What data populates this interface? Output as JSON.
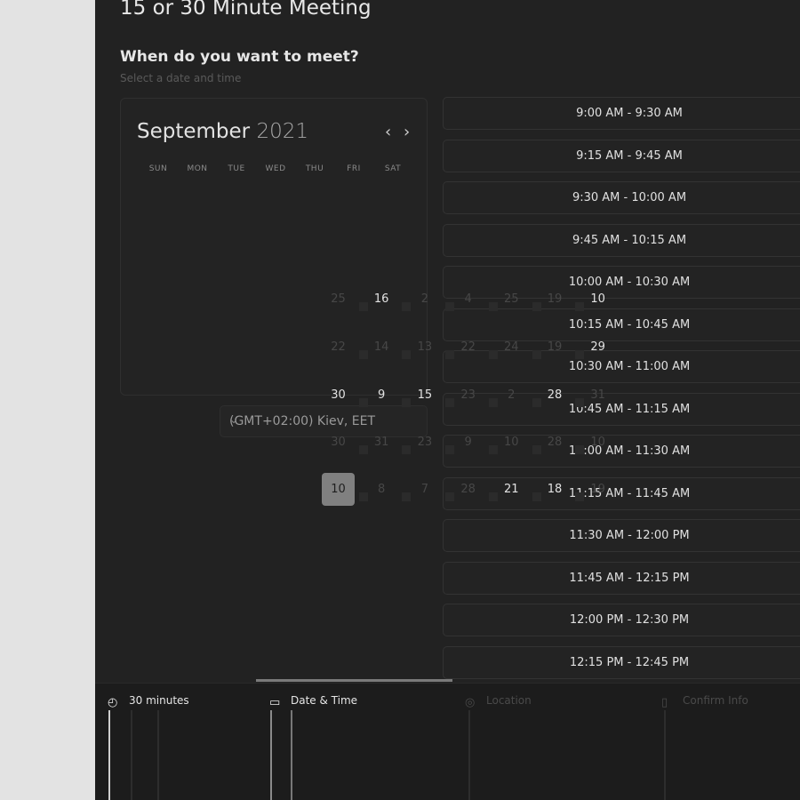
{
  "page": {
    "title": "15 or 30 Minute Meeting",
    "question": "When do you want to meet?",
    "subtitle": "Select a date and time"
  },
  "calendar": {
    "month": "September",
    "year": "2021",
    "prev_label": "‹",
    "next_label": "›",
    "weekdays": [
      "SUN",
      "MON",
      "TUE",
      "WED",
      "THU",
      "FRI",
      "SAT"
    ],
    "overlay_rows": [
      [
        "25",
        "16",
        "2",
        "4",
        "25",
        "19",
        "10"
      ],
      [
        "22",
        "14",
        "13",
        "22",
        "24",
        "19",
        "29"
      ],
      [
        "30",
        "9",
        "15",
        "23",
        "2",
        "28",
        "31"
      ],
      [
        "30",
        "31",
        "23",
        "9",
        "10",
        "28",
        "10"
      ],
      [
        "10",
        "8",
        "7",
        "28",
        "21",
        "18",
        "19"
      ]
    ],
    "selected_day": "10"
  },
  "timezone": {
    "label": "(GMT+02:00) Kiev, EET",
    "chevron": "⌄"
  },
  "time_slots": [
    "9:00 AM - 9:30 AM",
    "9:15 AM - 9:45 AM",
    "9:30 AM - 10:00 AM",
    "9:45 AM - 10:15 AM",
    "10:00 AM - 10:30 AM",
    "10:15 AM - 10:45 AM",
    "10:30 AM - 11:00 AM",
    "10:45 AM - 11:15 AM",
    "11:00 AM - 11:30 AM",
    "11:15 AM - 11:45 AM",
    "11:30 AM - 12:00 PM",
    "11:45 AM - 12:15 PM",
    "12:00 PM - 12:30 PM",
    "12:15 PM - 12:45 PM"
  ],
  "steps": [
    {
      "label": "30 minutes",
      "icon": "clock-icon",
      "state": "done"
    },
    {
      "label": "Date & Time",
      "icon": "calendar-icon",
      "state": "active"
    },
    {
      "label": "Location",
      "icon": "location-pin-icon",
      "state": "pending"
    },
    {
      "label": "Confirm Info",
      "icon": "document-icon",
      "state": "pending"
    }
  ],
  "colors": {
    "panel_bg": "#222222",
    "outer_bg": "#e3e3e3",
    "selected_bg": "#808080"
  }
}
